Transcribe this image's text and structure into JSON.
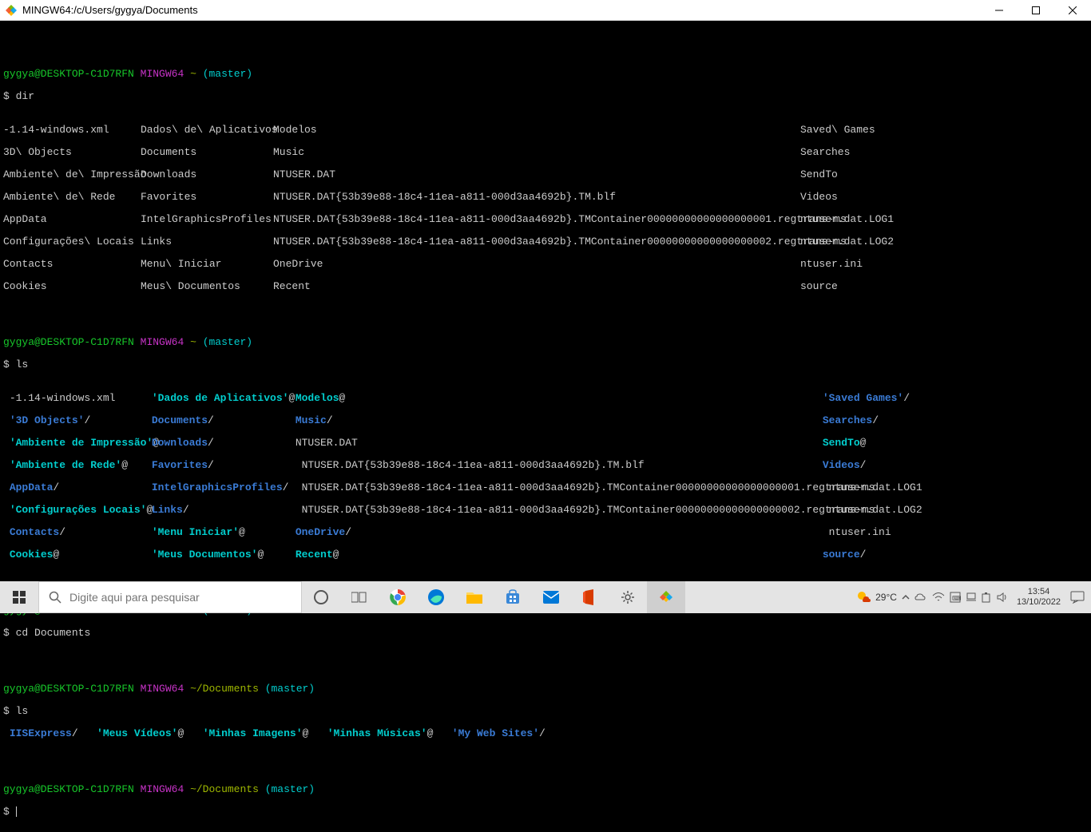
{
  "window": {
    "title": "MINGW64:/c/Users/gygya/Documents"
  },
  "prompt": {
    "user": "gygya@DESKTOP-C1D7RFN",
    "shell": "MINGW64",
    "home": "~",
    "docs": "~/Documents",
    "branch": "(master)",
    "dollar": "$"
  },
  "cmd": {
    "dir": "dir",
    "ls": "ls",
    "cd": "cd Documents"
  },
  "dir_out": {
    "c1r1": "-1.14-windows.xml",
    "c1r2": "3D\\ Objects",
    "c1r3": "Ambiente\\ de\\ Impressão",
    "c1r4": "Ambiente\\ de\\ Rede",
    "c1r5": "AppData",
    "c1r6": "Configurações\\ Locais",
    "c1r7": "Contacts",
    "c1r8": "Cookies",
    "c2r1": "Dados\\ de\\ Aplicativos",
    "c2r2": "Documents",
    "c2r3": "Downloads",
    "c2r4": "Favorites",
    "c2r5": "IntelGraphicsProfiles",
    "c2r6": "Links",
    "c2r7": "Menu\\ Iniciar",
    "c2r8": "Meus\\ Documentos",
    "c3r1": "Modelos",
    "c3r2": "Music",
    "c3r3": "NTUSER.DAT",
    "c3r4": "NTUSER.DAT{53b39e88-18c4-11ea-a811-000d3aa4692b}.TM.blf",
    "c3r5": "NTUSER.DAT{53b39e88-18c4-11ea-a811-000d3aa4692b}.TMContainer00000000000000000001.regtrans-ms",
    "c3r6": "NTUSER.DAT{53b39e88-18c4-11ea-a811-000d3aa4692b}.TMContainer00000000000000000002.regtrans-ms",
    "c3r7": "OneDrive",
    "c3r8": "Recent",
    "c4r1": "Saved\\ Games",
    "c4r2": "Searches",
    "c4r3": "SendTo",
    "c4r4": "Videos",
    "c4r5": "ntuser.dat.LOG1",
    "c4r6": "ntuser.dat.LOG2",
    "c4r7": "ntuser.ini",
    "c4r8": "source"
  },
  "ls_out": {
    "r1_a": "-1.14-windows.xml",
    "r1_b": "'Dados de Aplicativos'",
    "r1_c": "Modelos",
    "r1_d": "'Saved Games'",
    "r2_a": "'3D Objects'",
    "r2_b": "Documents",
    "r2_c": "Music",
    "r2_d": "Searches",
    "r3_a": "'Ambiente de Impressão'",
    "r3_b": "Downloads",
    "r3_c": "NTUSER.DAT",
    "r3_d": "SendTo",
    "r4_a": "'Ambiente de Rede'",
    "r4_b": "Favorites",
    "r4_c": " NTUSER.DAT{53b39e88-18c4-11ea-a811-000d3aa4692b}.TM.blf",
    "r4_d": "Videos",
    "r5_a": "AppData",
    "r5_b": "IntelGraphicsProfiles",
    "r5_c": " NTUSER.DAT{53b39e88-18c4-11ea-a811-000d3aa4692b}.TMContainer00000000000000000001.regtrans-ms",
    "r5_d": " ntuser.dat.LOG1",
    "r6_a": "'Configurações Locais'",
    "r6_b": "Links",
    "r6_c": " NTUSER.DAT{53b39e88-18c4-11ea-a811-000d3aa4692b}.TMContainer00000000000000000002.regtrans-ms",
    "r6_d": " ntuser.dat.LOG2",
    "r7_a": "Contacts",
    "r7_b": "'Menu Iniciar'",
    "r7_c": "OneDrive",
    "r7_d": " ntuser.ini",
    "r8_a": "Cookies",
    "r8_b": "'Meus Documentos'",
    "r8_c": "Recent",
    "r8_d": "source"
  },
  "docs_ls": {
    "a": "IISExpress",
    "b": "'Meus Vídeos'",
    "c": "'Minhas Imagens'",
    "d": "'Minhas Músicas'",
    "e": "'My Web Sites'"
  },
  "taskbar": {
    "search_placeholder": "Digite aqui para pesquisar",
    "weather": "29°C",
    "time": "13:54",
    "date": "13/10/2022"
  }
}
